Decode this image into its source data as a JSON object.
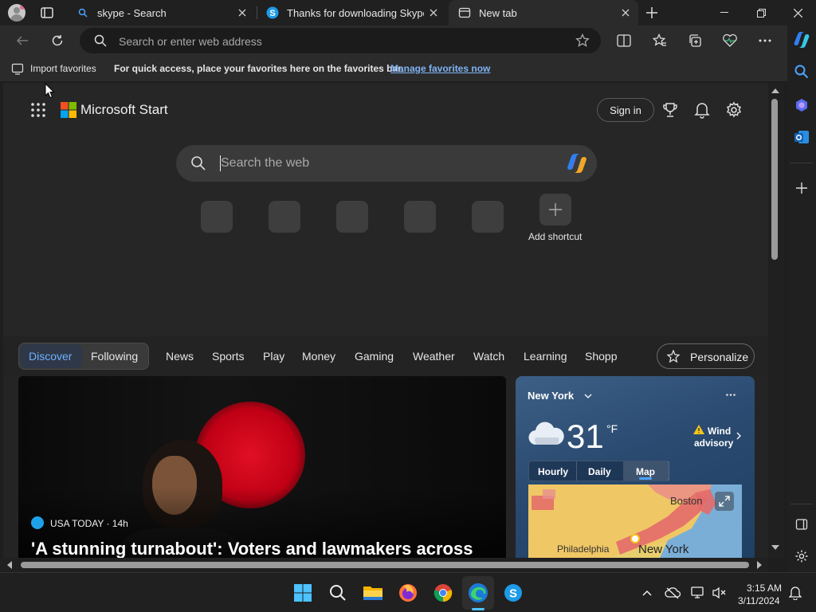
{
  "tabs": [
    {
      "title": "skype - Search",
      "icon": "bing-search-icon"
    },
    {
      "title": "Thanks for downloading Skype",
      "icon": "skype-icon"
    },
    {
      "title": "New tab",
      "icon": "new-tab-icon"
    }
  ],
  "address_bar": {
    "placeholder": "Search or enter web address"
  },
  "favorites_bar": {
    "import_label": "Import favorites",
    "message": "For quick access, place your favorites here on the favorites bar.",
    "manage_link": "Manage favorites now"
  },
  "start": {
    "brand": "Microsoft Start",
    "sign_in": "Sign in",
    "search_placeholder": "Search the web",
    "add_shortcut": "Add shortcut",
    "shortcut_count": 5
  },
  "feed_nav": {
    "tabs": [
      "Discover",
      "Following"
    ],
    "items": [
      "News",
      "Sports",
      "Play",
      "Money",
      "Gaming",
      "Weather",
      "Watch",
      "Learning",
      "Shopp"
    ],
    "personalize": "Personalize"
  },
  "story": {
    "source": "USA TODAY · 14h",
    "headline": "'A stunning turnabout': Voters and lawmakers across"
  },
  "weather": {
    "location": "New York",
    "temperature": "31",
    "unit": "°F",
    "alert_line1": "Wind",
    "alert_line2": "advisory",
    "tabs": [
      "Hourly",
      "Daily",
      "Map"
    ],
    "map_labels": [
      "Boston",
      "Philadelphia",
      "New York"
    ]
  },
  "taskbar": {
    "time": "3:15 AM",
    "date": "3/11/2024"
  },
  "colors": {
    "accent_blue": "#4da3ff",
    "link": "#7fb3f5",
    "tab_active": "#2b2b2b"
  }
}
